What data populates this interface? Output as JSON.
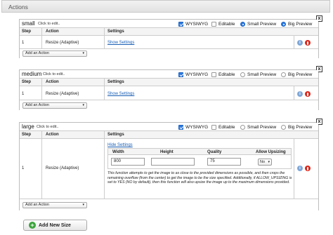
{
  "header": {
    "title": "Actions"
  },
  "common": {
    "click_to_edit": "Click to edit..",
    "col_step": "Step",
    "col_action": "Action",
    "col_settings": "Settings",
    "add_action": "Add an Action",
    "close": "x",
    "info": "i"
  },
  "options": {
    "wysiwyg": "WYSIWYG",
    "editable": "Editable",
    "small_preview": "Small Preview",
    "big_preview": "Big Preview"
  },
  "sizes": [
    {
      "name": "small",
      "wysiwyg": true,
      "editable": false,
      "preview": "big",
      "step": "1",
      "action": "Resize (Adaptive)",
      "settings_link": "Show Settings"
    },
    {
      "name": "medium",
      "wysiwyg": true,
      "editable": false,
      "preview": "none",
      "step": "1",
      "action": "Resize (Adaptive)",
      "settings_link": "Show Settings"
    },
    {
      "name": "large",
      "wysiwyg": true,
      "editable": false,
      "preview": "none",
      "step": "1",
      "action": "Resize (Adaptive)",
      "settings_link": "Hide Settings",
      "settings": {
        "col_width": "Width",
        "col_height": "Height",
        "col_quality": "Quality",
        "col_upsizing": "Allow Upsizing",
        "width": "800",
        "height": "",
        "quality": "75",
        "upsizing": "No",
        "description": "This function attempts to get the image to as close to the provided dimensions as possible, and then crops the remaining overflow (from the center) to get the image to be the size specified. Additionally, if ALLOW_UPSIZING is set to YES (NO by default), then this function will also upsize the image up to the maximum dimensions provided."
      }
    }
  ],
  "footer": {
    "add_new_size": "Add New Size"
  },
  "colors": {
    "accent": "#2a7be4",
    "delete": "#d9261c",
    "info": "#7fa7d8",
    "add": "#3aa43a",
    "link": "#1a5fb4"
  }
}
